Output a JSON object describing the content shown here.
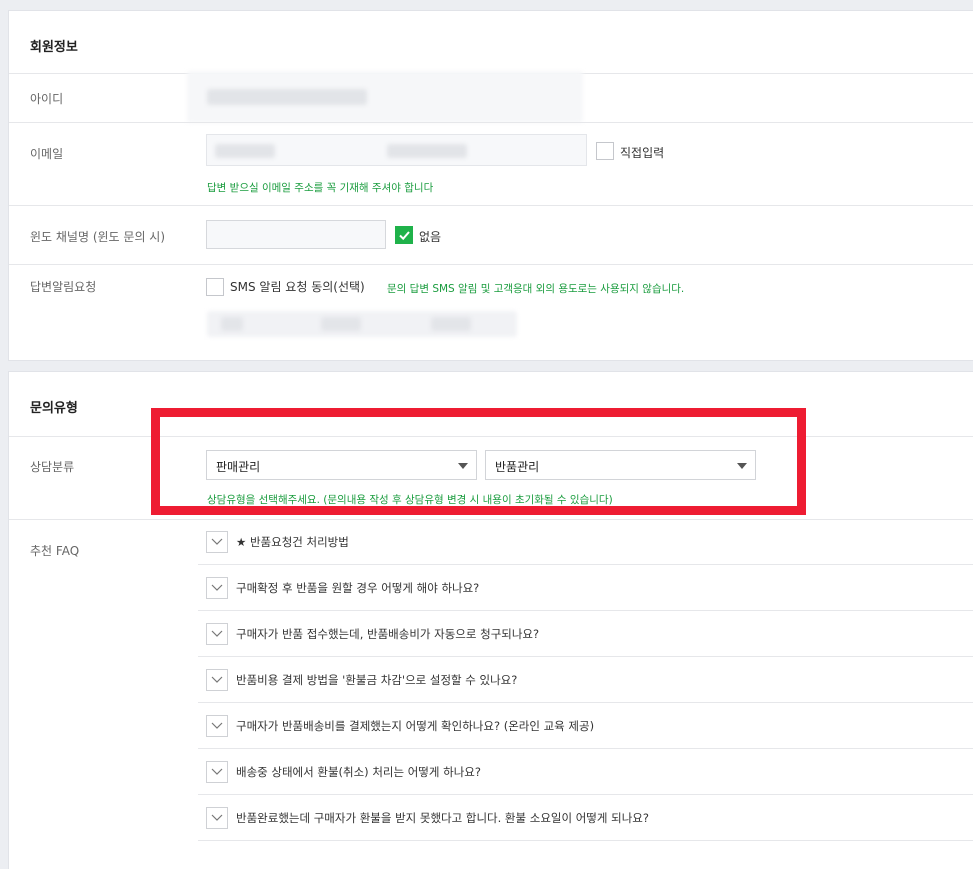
{
  "member_info": {
    "title": "회원정보",
    "id_label": "아이디",
    "email_label": "이메일",
    "direct_input_label": "직접입력",
    "email_hint": "답변 받으실 이메일 주소를 꼭 기재해 주셔야 합니다",
    "window_channel_label": "윈도 채널명 (윈도 문의 시)",
    "window_channel_value": "",
    "none_label": "없음",
    "notify_label": "답변알림요청",
    "sms_consent_label": "SMS 알림 요청 동의(선택)",
    "sms_hint": "문의 답변 SMS 알림 및 고객응대 외의 용도로는 사용되지 않습니다."
  },
  "inquiry_type": {
    "title": "문의유형",
    "category_label": "상담분류",
    "select1_value": "판매관리",
    "select2_value": "반품관리",
    "category_hint": "상담유형을 선택해주세요. (문의내용 작성 후 상담유형 변경 시 내용이 초기화될 수 있습니다)",
    "faq_label": "추천 FAQ",
    "faq_items": [
      "★ 반품요청건 처리방법",
      "구매확정 후 반품을 원할 경우 어떻게 해야 하나요?",
      "구매자가 반품 접수했는데, 반품배송비가 자동으로 청구되나요?",
      "반품비용 결제 방법을 '환불금 차감'으로 설정할 수 있나요?",
      "구매자가 반품배송비를 결제했는지 어떻게 확인하나요? (온라인 교육 제공)",
      "배송중 상태에서 환불(취소) 처리는 어떻게 하나요?",
      "반품완료했는데 구매자가 환불을 받지 못했다고 합니다. 환불 소요일이 어떻게 되나요?"
    ]
  },
  "colors": {
    "highlight": "#ee1c32",
    "accent_green": "#1fb24a",
    "hint_green": "#1a9c3e"
  }
}
